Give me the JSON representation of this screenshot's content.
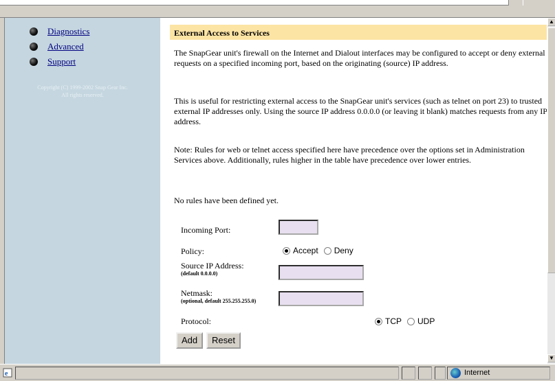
{
  "browser": {
    "status_zone": "Internet"
  },
  "sidebar": {
    "items": [
      {
        "label": "Diagnostics",
        "icon": "bullet-icon"
      },
      {
        "label": "Advanced",
        "icon": "bullet-icon"
      },
      {
        "label": "Support",
        "icon": "bullet-icon"
      }
    ],
    "copyright_line1": "Copyright (C) 1999-2002 Snap Gear Inc.",
    "copyright_line2": "All rights reserved."
  },
  "content": {
    "section_title": "External Access to Services",
    "paragraph1": "The SnapGear unit's firewall on the Internet and Dialout interfaces may be configured to accept or deny external requests on a specified incoming port, based on the originating (source) IP address.",
    "paragraph2": "This is useful for restricting external access to the SnapGear unit's services (such as telnet on port 23) to trusted external IP addresses only. Using the source IP address 0.0.0.0 (or leaving it blank) matches requests from any IP address.",
    "paragraph3": "Note: Rules for web or telnet access specified here have precedence over the options set in Administration Services above. Additionally, rules higher in the table have precedence over lower entries.",
    "no_rules": "No rules have been defined yet."
  },
  "form": {
    "incoming_port_label": "Incoming Port:",
    "incoming_port_value": "",
    "policy_label": "Policy:",
    "policy_accept": "Accept",
    "policy_deny": "Deny",
    "policy_selected": "Accept",
    "source_ip_label": "Source IP Address:",
    "source_ip_hint": "(default 0.0.0.0)",
    "source_ip_value": "",
    "netmask_label": "Netmask:",
    "netmask_hint": "(optional, default 255.255.255.0)",
    "netmask_value": "",
    "protocol_label": "Protocol:",
    "protocol_tcp": "TCP",
    "protocol_udp": "UDP",
    "protocol_selected": "TCP",
    "add_label": "Add",
    "reset_label": "Reset"
  },
  "colors": {
    "sidebar_bg": "#c5d6e0",
    "header_bg": "#fce4a4",
    "input_bg": "#e8e0f0",
    "link": "#00007f"
  }
}
